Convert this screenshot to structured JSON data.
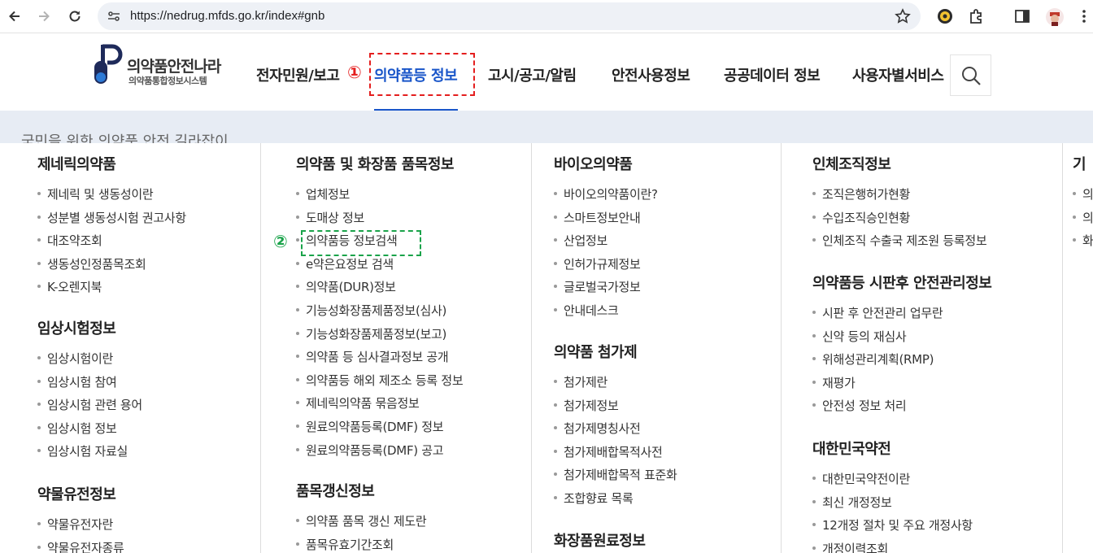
{
  "browser": {
    "url": "https://nedrug.mfds.go.kr/index#gnb"
  },
  "site": {
    "logo_title": "의약품안전나라",
    "logo_subtitle": "의약품통합정보시스템",
    "nav": [
      "전자민원/보고",
      "의약품등 정보",
      "고시/공고/알림",
      "안전사용정보",
      "공공데이터 정보",
      "사용자별서비스"
    ],
    "active_nav": "의약품등 정보",
    "marker_1": "①",
    "marker_2": "②",
    "banner_text": "국민을 위한 의약품 안전 길라잡이"
  },
  "menu": {
    "col1": {
      "g1": {
        "title": "제네릭의약품",
        "items": [
          "제네릭 및 생동성이란",
          "성분별 생동성시험 권고사항",
          "대조약조회",
          "생동성인정품목조회",
          "K-오렌지북"
        ]
      },
      "g2": {
        "title": "임상시험정보",
        "items": [
          "임상시험이란",
          "임상시험 참여",
          "임상시험 관련 용어",
          "임상시험 정보",
          "임상시험 자료실"
        ]
      },
      "g3": {
        "title": "약물유전정보",
        "items": [
          "약물유전자란",
          "약물유전자종류"
        ]
      }
    },
    "col2": {
      "g1": {
        "title": "의약품 및 화장품 품목정보",
        "items": [
          "업체정보",
          "도매상 정보",
          "의약품등 정보검색",
          "e약은요정보 검색",
          "의약품(DUR)정보",
          "기능성화장품제품정보(심사)",
          "기능성화장품제품정보(보고)",
          "의약품 등 심사결과정보 공개",
          "의약품등 해외 제조소 등록 정보",
          "제네릭의약품 묶음정보",
          "원료의약품등록(DMF) 정보",
          "원료의약품등록(DMF) 공고"
        ]
      },
      "g2": {
        "title": "품목갱신정보",
        "items": [
          "의약품 품목 갱신 제도란",
          "품목유효기간조회"
        ]
      }
    },
    "col3": {
      "g1": {
        "title": "바이오의약품",
        "items": [
          "바이오의약품이란?",
          "스마트정보안내",
          "산업정보",
          "인허가규제정보",
          "글로벌국가정보",
          "안내데스크"
        ]
      },
      "g2": {
        "title": "의약품 첨가제",
        "items": [
          "첨가제란",
          "첨가제정보",
          "첨가제명칭사전",
          "첨가제배합목적사전",
          "첨가제배합목적 표준화",
          "조합향료 목록"
        ]
      },
      "g3": {
        "title": "화장품원료정보",
        "items": []
      }
    },
    "col4": {
      "g1": {
        "title": "인체조직정보",
        "items": [
          "조직은행허가현황",
          "수입조직승인현황",
          "인체조직 수출국 제조원 등록정보"
        ]
      },
      "g2": {
        "title": "의약품등 시판후 안전관리정보",
        "items": [
          "시판 후 안전관리 업무란",
          "신약 등의 재심사",
          "위해성관리계획(RMP)",
          "재평가",
          "안전성 정보 처리"
        ]
      },
      "g3": {
        "title": "대한민국약전",
        "items": [
          "대한민국약전이란",
          "최신 개정정보",
          "12개정 절차 및 주요 개정사항",
          "개정이력조회"
        ]
      }
    },
    "col5": {
      "g1": {
        "title": "기",
        "items": [
          "의",
          "의",
          "화"
        ]
      }
    }
  }
}
